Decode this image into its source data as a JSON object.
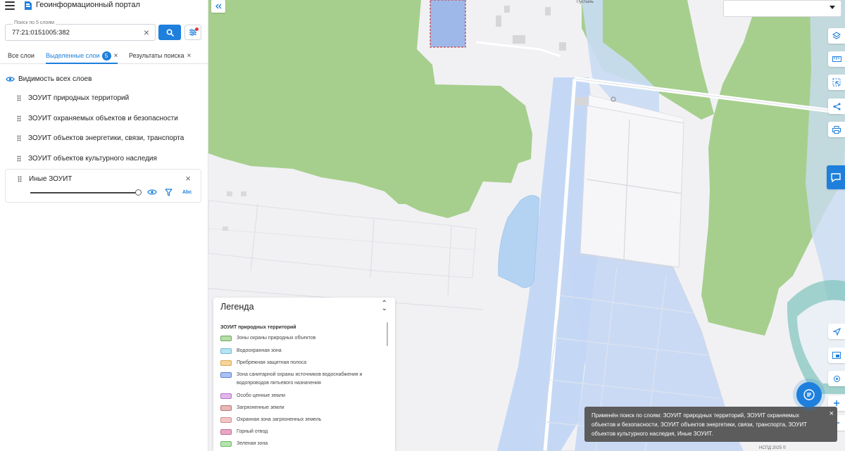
{
  "app": {
    "title": "Геоинформационный портал",
    "menu_icon": "burger-icon",
    "logo_icon": "portal-logo-icon"
  },
  "search": {
    "label": "Поиск по 5 слоям",
    "value": "77:21:0151005:382",
    "clear_icon": "clear-icon",
    "button_icon": "search-icon",
    "filter_icon": "filter-settings-icon"
  },
  "tabs": [
    {
      "label": "Все слои"
    },
    {
      "label": "Выделенные слои",
      "badge": "5",
      "active": true
    },
    {
      "label": "Результаты поиска"
    }
  ],
  "visibility": {
    "label": "Видимость всех слоев",
    "icon": "eye-icon"
  },
  "layers": [
    {
      "label": "ЗОУИТ природных территорий"
    },
    {
      "label": "ЗОУИТ охраняемых объектов и безопасности"
    },
    {
      "label": "ЗОУИТ объектов энергетики, связи, транспорта"
    },
    {
      "label": "ЗОУИТ объектов культурного наследия"
    },
    {
      "label": "Иные ЗОУИТ",
      "expanded": true,
      "opacity": 1.0,
      "labels_toggle": "Abc"
    }
  ],
  "map": {
    "place_label": "Пустынь",
    "legend": {
      "title": "Легенда",
      "section": "ЗОУИТ природных территорий",
      "items": [
        {
          "label": "Зоны охраны природных объектов",
          "color": "#b8dca8",
          "border": "#6aaa5a"
        },
        {
          "label": "Водоохранная зона",
          "color": "#b7e4f2",
          "border": "#6cb8d2"
        },
        {
          "label": "Прибрежная защитная полоса",
          "color": "#f6d49a",
          "border": "#d9a850"
        },
        {
          "label": "Зона санитарной охраны источников водоснабжения и водопроводов питьевого назначения",
          "color": "#a9c3f2",
          "border": "#5f7fd0"
        },
        {
          "label": "Особо ценные земли",
          "color": "#e2b8ea",
          "border": "#b573c8"
        },
        {
          "label": "Загрязненные земли",
          "color": "#e6b8b8",
          "border": "#b97474"
        },
        {
          "label": "Охранная зона загрязненных земель",
          "color": "#f2c6c6",
          "border": "#cf8e8e"
        },
        {
          "label": "Горный отвод",
          "color": "#e8a8c4",
          "border": "#bf6a92"
        },
        {
          "label": "Зеленая зона",
          "color": "#b6e2b0",
          "border": "#6cba64"
        }
      ]
    },
    "toast": "Применён поиск по слоям: ЗОУИТ природных территорий, ЗОУИТ охраняемых объектов и безопасности, ЗОУИТ объектов энергетики, связи, транспорта, ЗОУИТ объектов культурного наследия, Иные ЗОУИТ.",
    "attribution": "НСПД 2025 ©",
    "tools": [
      "layers-icon",
      "ruler-icon",
      "select-area-icon",
      "share-icon",
      "print-icon",
      "chat-bubble-icon",
      "locate-icon",
      "basemap-icon",
      "geolocation-icon",
      "zoom-in-icon",
      "zoom-out-icon"
    ]
  },
  "colors": {
    "accent": "#1e7fdc",
    "forest": "#a6cf8d",
    "water": "#b9d2f2",
    "land": "#f1f1f4"
  }
}
